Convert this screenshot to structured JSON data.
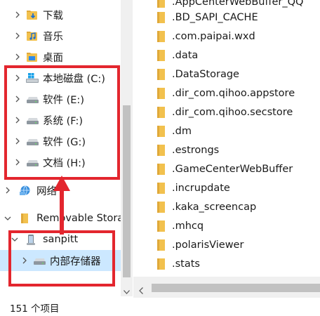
{
  "nav": {
    "items": [
      {
        "label": "下载",
        "icon": "download-folder-icon",
        "chevron": "right"
      },
      {
        "label": "音乐",
        "icon": "music-folder-icon",
        "chevron": "right"
      },
      {
        "label": "桌面",
        "icon": "desktop-folder-icon",
        "chevron": "right"
      },
      {
        "label": "本地磁盘 (C:)",
        "icon": "windows-drive-icon",
        "chevron": "right"
      },
      {
        "label": "软件 (E:)",
        "icon": "drive-icon",
        "chevron": "right"
      },
      {
        "label": "系统 (F:)",
        "icon": "drive-icon",
        "chevron": "right"
      },
      {
        "label": "软件 (G:)",
        "icon": "drive-icon",
        "chevron": "right"
      },
      {
        "label": "文档 (H:)",
        "icon": "drive-icon",
        "chevron": "right"
      },
      {
        "label": "网络",
        "icon": "network-icon",
        "chevron": "right"
      },
      {
        "label": "Removable Storage",
        "icon": "folder-icon",
        "chevron": "down"
      },
      {
        "label": "sanpitt",
        "icon": "phone-icon",
        "chevron": "down"
      },
      {
        "label": "内部存储器",
        "icon": "drive-icon",
        "chevron": "right"
      }
    ]
  },
  "files": {
    "items": [
      ".AppCenterWebBuffer_QQ",
      ".BD_SAPI_CACHE",
      ".com.paipai.wxd",
      ".data",
      ".DataStorage",
      ".dir_com.qihoo.appstore",
      ".dir_com.qihoo.secstore",
      ".dm",
      ".estrongs",
      ".GameCenterWebBuffer",
      ".incrupdate",
      ".kaka_screencap",
      ".mhcq",
      ".polarisViewer",
      ".stats"
    ]
  },
  "status": {
    "item_count": "151 个项目"
  },
  "colors": {
    "annotation": "#e3262e",
    "selection": "#cce8ff",
    "folder": "#f2c14e"
  }
}
